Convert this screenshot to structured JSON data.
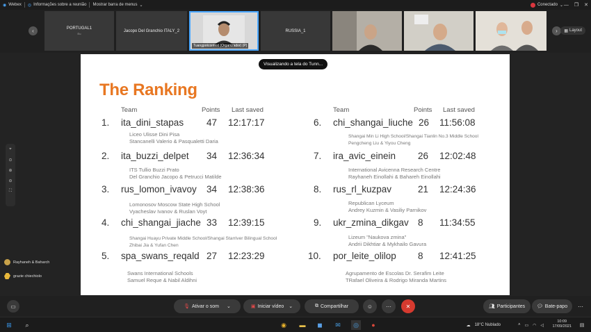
{
  "topbar": {
    "app": "Webex",
    "info": "Informações sobre a reunião",
    "menu": "Mostrar barra de menus",
    "status": "Conectado"
  },
  "participants": [
    {
      "name": "PORTUGAL1",
      "sub": "Eu",
      "video": false
    },
    {
      "name": "Jacopo Del Granchio ITALY_2",
      "sub": "",
      "video": false
    },
    {
      "name": "Tuangpotcontest  (Organizador) (P)",
      "sub": "",
      "video": true,
      "active": true
    },
    {
      "name": "RUSSIA_1",
      "sub": "",
      "video": false
    },
    {
      "name": "",
      "sub": "",
      "video": true
    },
    {
      "name": "",
      "sub": "",
      "video": true
    },
    {
      "name": "",
      "sub": "",
      "video": true
    }
  ],
  "layout_label": "Layout",
  "share_pill": "Visualizando a tela do Tunn...",
  "slide": {
    "title": "The Ranking",
    "headers": {
      "team": "Team",
      "points": "Points",
      "saved": "Last saved"
    },
    "left": [
      {
        "rank": "1.",
        "team": "ita_dini_stapas",
        "points": "47",
        "saved": "12:17:17",
        "school": "Liceo Ulisse Dini Pisa",
        "members": "Stancanelli Valerio & Pasqualetti Daria"
      },
      {
        "rank": "2.",
        "team": "ita_buzzi_delpet",
        "points": "34",
        "saved": "12:36:34",
        "school": "ITS Tullio Buzzi Prato",
        "members": "Del Granchio Jacopo & Petrucci Matilde"
      },
      {
        "rank": "3.",
        "team": "rus_lomon_ivavoy",
        "points": "34",
        "saved": "12:38:36",
        "school": "Lomonosov Moscow State High School",
        "members": "Vyacheslav Ivanov & Ruslan Voyt"
      },
      {
        "rank": "4.",
        "team": "chi_shangai_jiache",
        "points": "33",
        "saved": "12:39:15",
        "school": "Shangai Huayu Private Middle School/Shangai Starriver Bilingual School",
        "members": "Zhibai Jia & Yufan Chen"
      },
      {
        "rank": "5.",
        "team": "spa_swans_reqald",
        "points": "27",
        "saved": "12:23:29",
        "school": "Swans International Schools",
        "members": "Samuel Reque & Nabil Aldihni"
      }
    ],
    "right": [
      {
        "rank": "6.",
        "team": "chi_shangai_liuche",
        "points": "26",
        "saved": "11:56:08",
        "school": "Shangai Min Li High School/Shangai Tianlin No.3 Middle School",
        "members": "Pengcheng Liu & Yiyou Cheng"
      },
      {
        "rank": "7.",
        "team": "ira_avic_einein",
        "points": "26",
        "saved": "12:02:48",
        "school": "International Avicenna Research Centre",
        "members": "Rayhaneh Einollahi & Bahareh Einollahi"
      },
      {
        "rank": "8.",
        "team": "rus_rl_kuzpav",
        "points": "21",
        "saved": "12:24:36",
        "school": "Republican Lyceum",
        "members": "Andrey Kuzmin & Vasiliy Parnikov"
      },
      {
        "rank": "9.",
        "team": "ukr_zmina_dikgav",
        "points": "8",
        "saved": "11:34:55",
        "school": "Lizeum \"Naukova zmina\"",
        "members": "Andrii Dikhtiar & Mykhailo Gavura"
      },
      {
        "rank": "10.",
        "team": "por_leite_olilop",
        "points": "8",
        "saved": "12:41:25",
        "school": "Agrupamento de Escolas Dr. Serafim Leite",
        "members": "TRafael Oliveira & Rodrigo Miranda Martins"
      }
    ]
  },
  "side_participants": [
    {
      "name": "Rayhaneh & Baharch"
    },
    {
      "name": "grazie chiechiolo"
    }
  ],
  "toolbar": {
    "audio": "Ativar o som",
    "video": "Iniciar vídeo",
    "share": "Compartilhar",
    "participants": "Participantes",
    "chat": "Bate-papo"
  },
  "taskbar": {
    "weather": "18°C Nublado",
    "time": "10:09",
    "date": "17/09/2021"
  },
  "colors": {
    "accent": "#e87722",
    "leave": "#d63a2f",
    "active_border": "#4aa8ff"
  }
}
